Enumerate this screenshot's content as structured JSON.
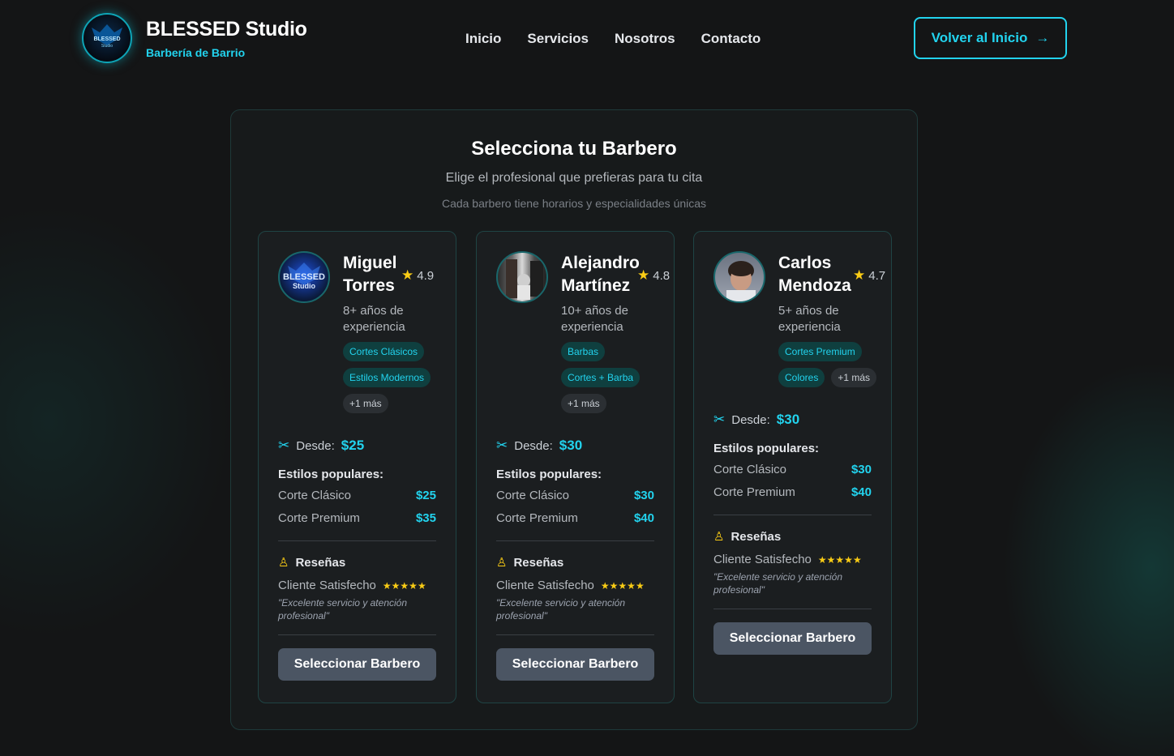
{
  "header": {
    "brand_title": "BLESSED Studio",
    "brand_subtitle": "Barbería de Barrio",
    "logo_text_top": "BLESSED",
    "logo_text_bottom": "Studio",
    "nav": [
      "Inicio",
      "Servicios",
      "Nosotros",
      "Contacto"
    ],
    "back_button": "Volver al Inicio"
  },
  "section": {
    "title": "Selecciona tu Barbero",
    "subtitle": "Elige el profesional que prefieras para tu cita",
    "note": "Cada barbero tiene horarios y especialidades únicas"
  },
  "labels": {
    "desde": "Desde:",
    "popular": "Estilos populares:",
    "reviews": "Reseñas",
    "select": "Seleccionar Barbero"
  },
  "barbers": [
    {
      "name": "Miguel Torres",
      "rating": "4.9",
      "experience": "8+ años de experiencia",
      "specialties": [
        "Cortes Clásicos",
        "Estilos Modernos"
      ],
      "more": "+1 más",
      "desde": "$25",
      "styles": [
        {
          "name": "Corte Clásico",
          "price": "$25"
        },
        {
          "name": "Corte Premium",
          "price": "$35"
        }
      ],
      "review_author": "Cliente Satisfecho",
      "review_stars": "★★★★★",
      "review_text": "\"Excelente servicio y atención profesional\"",
      "avatar_type": "logo"
    },
    {
      "name": "Alejandro Martínez",
      "rating": "4.8",
      "experience": "10+ años de experiencia",
      "specialties": [
        "Barbas",
        "Cortes + Barba"
      ],
      "more": "+1 más",
      "desde": "$30",
      "styles": [
        {
          "name": "Corte Clásico",
          "price": "$30"
        },
        {
          "name": "Corte Premium",
          "price": "$40"
        }
      ],
      "review_author": "Cliente Satisfecho",
      "review_stars": "★★★★★",
      "review_text": "\"Excelente servicio y atención profesional\"",
      "avatar_type": "photo"
    },
    {
      "name": "Carlos Mendoza",
      "rating": "4.7",
      "experience": "5+ años de experiencia",
      "specialties": [
        "Cortes Premium",
        "Colores"
      ],
      "more": "+1 más",
      "desde": "$30",
      "styles": [
        {
          "name": "Corte Clásico",
          "price": "$30"
        },
        {
          "name": "Corte Premium",
          "price": "$40"
        }
      ],
      "review_author": "Cliente Satisfecho",
      "review_stars": "★★★★★",
      "review_text": "\"Excelente servicio y atención profesional\"",
      "avatar_type": "photo"
    }
  ],
  "colors": {
    "accent": "#22d3ee",
    "star": "#facc15",
    "button": "#4b5563",
    "background": "#141516"
  }
}
